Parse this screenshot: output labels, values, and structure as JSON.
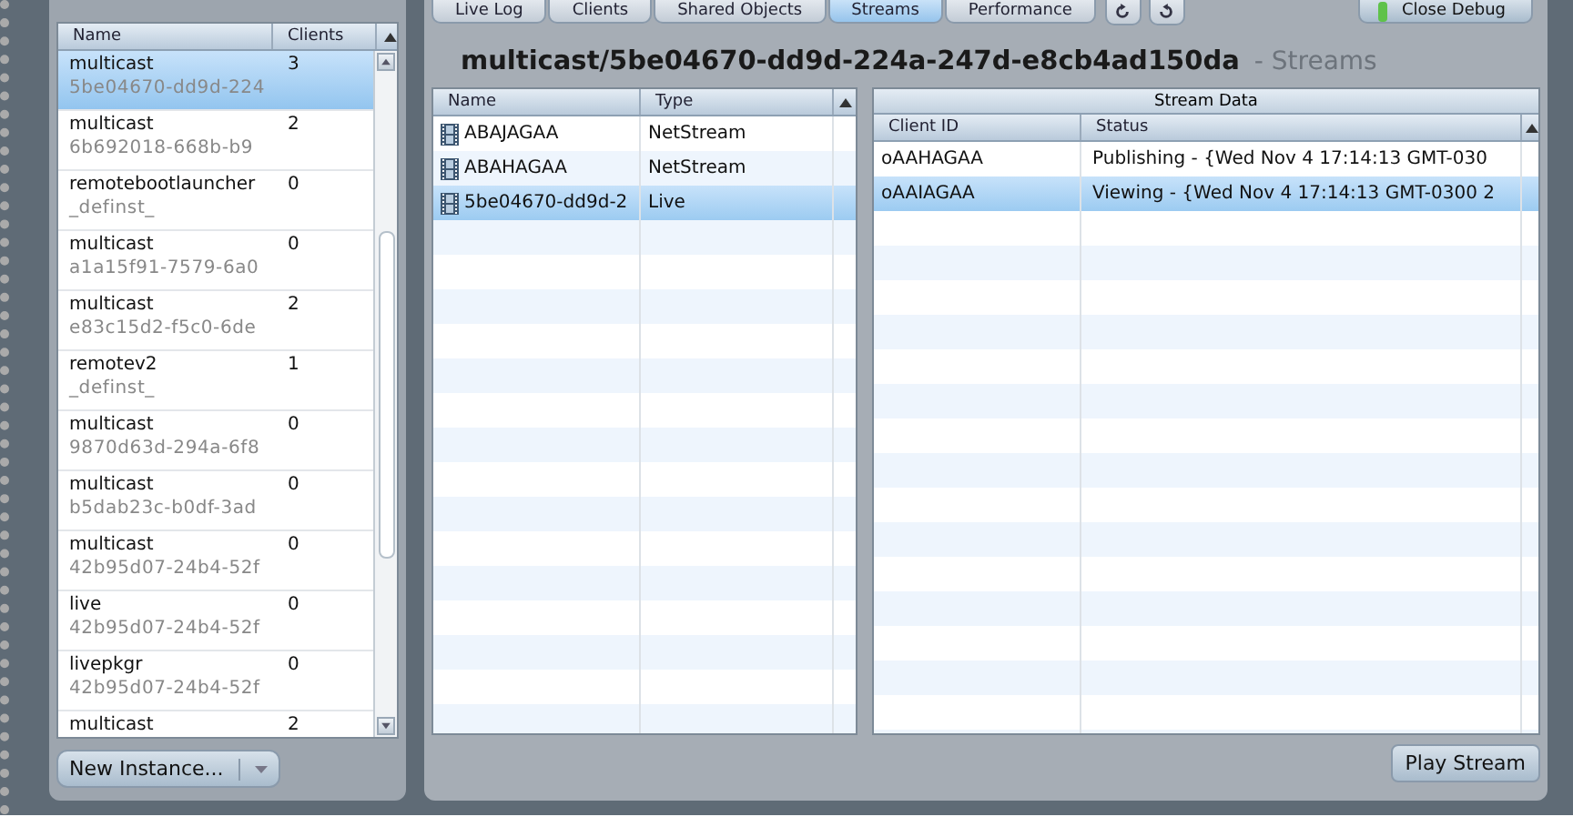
{
  "instances": {
    "columns": [
      "Name",
      "Clients"
    ],
    "rows": [
      {
        "name": "multicast",
        "id": "5be04670-dd9d-224",
        "clients": "3",
        "selected": true
      },
      {
        "name": "multicast",
        "id": "6b692018-668b-b9",
        "clients": "2",
        "selected": false
      },
      {
        "name": "remotebootlauncher",
        "id": "_definst_",
        "clients": "0",
        "selected": false
      },
      {
        "name": "multicast",
        "id": "a1a15f91-7579-6a0",
        "clients": "0",
        "selected": false
      },
      {
        "name": "multicast",
        "id": "e83c15d2-f5c0-6de",
        "clients": "2",
        "selected": false
      },
      {
        "name": "remotev2",
        "id": "_definst_",
        "clients": "1",
        "selected": false
      },
      {
        "name": "multicast",
        "id": "9870d63d-294a-6f8",
        "clients": "0",
        "selected": false
      },
      {
        "name": "multicast",
        "id": "b5dab23c-b0df-3ad",
        "clients": "0",
        "selected": false
      },
      {
        "name": "multicast",
        "id": "42b95d07-24b4-52f",
        "clients": "0",
        "selected": false
      },
      {
        "name": "live",
        "id": "42b95d07-24b4-52f",
        "clients": "0",
        "selected": false
      },
      {
        "name": "livepkgr",
        "id": "42b95d07-24b4-52f",
        "clients": "0",
        "selected": false
      },
      {
        "name": "multicast",
        "clients": "2",
        "selected": false
      }
    ],
    "new_button": "New Instance..."
  },
  "tabs": [
    {
      "label": "Live Log",
      "selected": false
    },
    {
      "label": "Clients",
      "selected": false
    },
    {
      "label": "Shared Objects",
      "selected": false
    },
    {
      "label": "Streams",
      "selected": true
    },
    {
      "label": "Performance",
      "selected": false
    }
  ],
  "close_button": "Close Debug",
  "title": "multicast/5be04670-dd9d-224a-247d-e8cb4ad150da",
  "subtitle": "- Streams",
  "streams": {
    "columns": [
      "Name",
      "Type"
    ],
    "rows": [
      {
        "name": "ABAJAGAA",
        "type": "NetStream",
        "selected": false
      },
      {
        "name": "ABAHAGAA",
        "type": "NetStream",
        "selected": false
      },
      {
        "name": "5be04670-dd9d-2",
        "type": "Live",
        "selected": true
      }
    ]
  },
  "stream_data": {
    "title": "Stream Data",
    "columns": [
      "Client ID",
      "Status"
    ],
    "rows": [
      {
        "client_id": "oAAHAGAA",
        "status": "Publishing - {Wed Nov 4 17:14:13 GMT-030",
        "selected": false
      },
      {
        "client_id": "oAAIAGAA",
        "status": "Viewing - {Wed Nov 4 17:14:13 GMT-0300 2",
        "selected": true
      }
    ]
  },
  "play_button": "Play Stream"
}
